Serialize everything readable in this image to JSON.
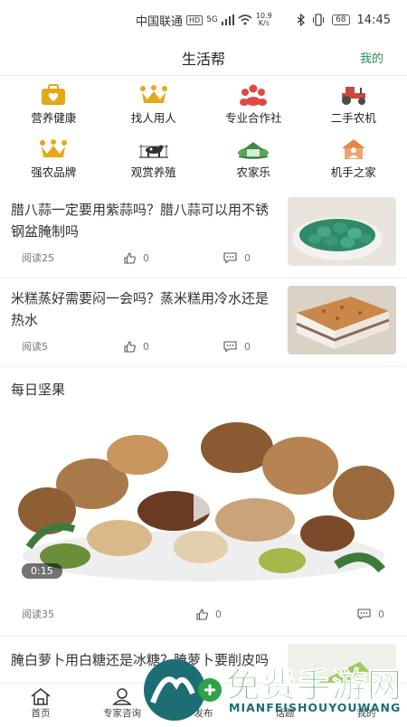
{
  "status_bar": {
    "carrier": "中国联通",
    "hd": "HD",
    "net": "5G",
    "speed_top": "10.9",
    "speed_bottom": "K/s",
    "battery": "68",
    "time": "14:45"
  },
  "header": {
    "title": "生活帮",
    "my_link": "我的"
  },
  "categories": [
    {
      "label": "营养健康",
      "icon": "medical-kit-icon"
    },
    {
      "label": "找人用人",
      "icon": "crown-icon"
    },
    {
      "label": "专业合作社",
      "icon": "people-group-icon"
    },
    {
      "label": "二手农机",
      "icon": "tractor-icon"
    },
    {
      "label": "强农品牌",
      "icon": "crown-icon"
    },
    {
      "label": "观赏养殖",
      "icon": "cattle-icon"
    },
    {
      "label": "农家乐",
      "icon": "farm-house-icon"
    },
    {
      "label": "机手之家",
      "icon": "house-person-icon"
    }
  ],
  "articles": [
    {
      "title": "腊八蒜一定要用紫蒜吗？腊八蒜可以用不锈钢盆腌制吗",
      "reads": "阅读25",
      "likes": "0",
      "comments": "0"
    },
    {
      "title": "米糕蒸好需要闷一会吗？蒸米糕用冷水还是热水",
      "reads": "阅读5",
      "likes": "0",
      "comments": "0"
    }
  ],
  "section": {
    "title": "每日坚果"
  },
  "video": {
    "duration": "0:15",
    "reads": "阅读35",
    "likes": "0",
    "comments": "0"
  },
  "article3": {
    "title": "腌白萝卜用白糖还是冰糖？腌萝卜要削皮吗"
  },
  "bottom_nav": [
    {
      "label": "首页",
      "icon": "home-icon"
    },
    {
      "label": "专家咨询",
      "icon": "expert-icon"
    },
    {
      "label": "发布",
      "icon": "publish-icon"
    },
    {
      "label": "话题",
      "icon": "topic-icon"
    },
    {
      "label": "我的",
      "icon": "user-icon"
    }
  ],
  "watermark": {
    "text": "免费手游网",
    "url_text": "MIANFEISHOUYOUWANG"
  }
}
